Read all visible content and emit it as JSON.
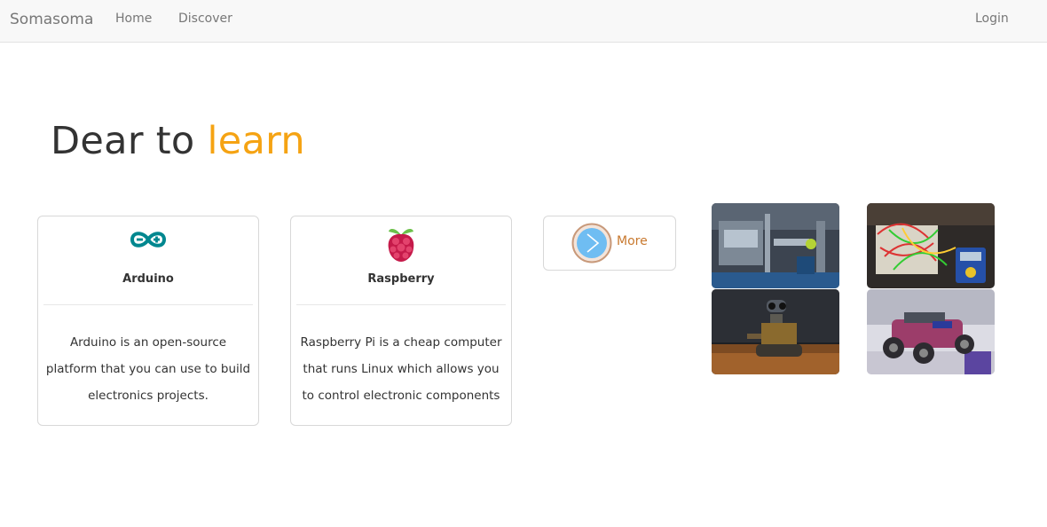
{
  "nav": {
    "brand": "Somasoma",
    "links": [
      {
        "label": "Home"
      },
      {
        "label": "Discover"
      }
    ],
    "login": "Login"
  },
  "hero": {
    "text": "Dear to",
    "accent": "learn",
    "accent_color": "#f5a313"
  },
  "cards": [
    {
      "icon": "arduino-logo-icon",
      "title": "Arduino",
      "description": "Arduino is an open-source platform that you can use to build electronics projects."
    },
    {
      "icon": "raspberry-pi-logo-icon",
      "title": "Raspberry",
      "description": "Raspberry Pi is a cheap computer that runs Linux which allows you to control electronic components"
    }
  ],
  "more": {
    "icon": "arrow-circle-icon",
    "label": "More",
    "color": "#c8792f"
  },
  "photos": [
    {
      "name": "robotic-arm-photo"
    },
    {
      "name": "breadboard-circuit-photo"
    },
    {
      "name": "wall-e-robot-photo"
    },
    {
      "name": "robot-car-photo"
    }
  ]
}
